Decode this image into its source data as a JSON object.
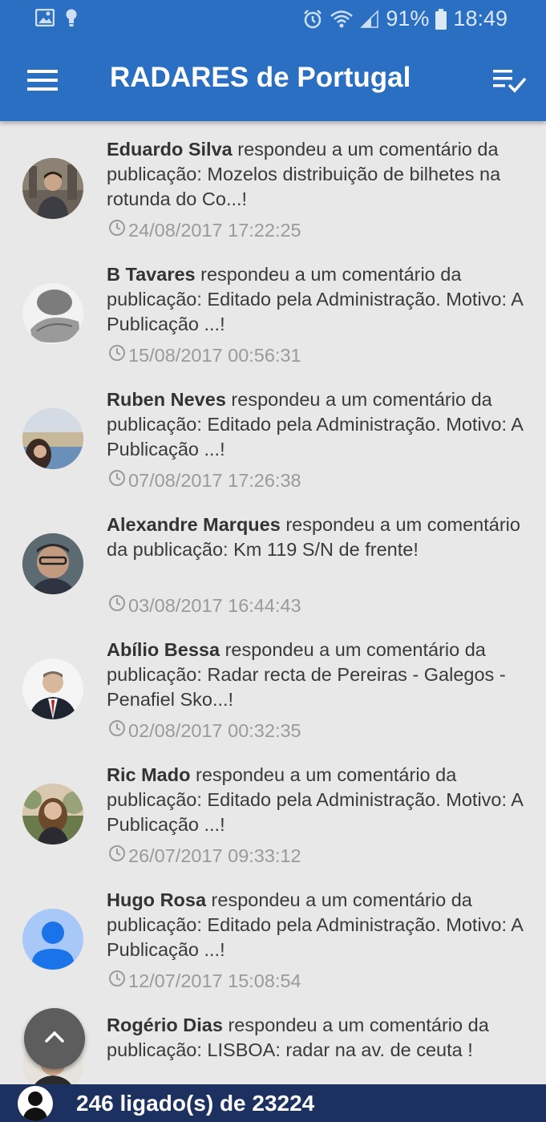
{
  "status_bar": {
    "battery": "91%",
    "time": "18:49"
  },
  "app": {
    "title": "RADARES de Portugal"
  },
  "notifications": [
    {
      "user": "Eduardo Silva",
      "action": " respondeu a um comentário da publicação: Mozelos distribuição de bilhetes na rotunda do Co...!",
      "timestamp": "24/08/2017 17:22:25"
    },
    {
      "user": "B Tavares",
      "action": " respondeu a um comentário da publicação: Editado pela Administração. Motivo: A Publicação ...!",
      "timestamp": "15/08/2017 00:56:31"
    },
    {
      "user": "Ruben Neves",
      "action": " respondeu a um comentário da publicação: Editado pela Administração. Motivo: A Publicação ...!",
      "timestamp": "07/08/2017 17:26:38"
    },
    {
      "user": "Alexandre Marques",
      "action": " respondeu a um comentário da publicação: Km 119 S/N de frente!",
      "timestamp": "03/08/2017 16:44:43"
    },
    {
      "user": "Abílio Bessa",
      "action": " respondeu a um comentário da publicação: Radar recta de Pereiras - Galegos - Penafiel Sko...!",
      "timestamp": "02/08/2017 00:32:35"
    },
    {
      "user": "Ric Mado",
      "action": " respondeu a um comentário da publicação: Editado pela Administração. Motivo: A Publicação ...!",
      "timestamp": "26/07/2017 09:33:12"
    },
    {
      "user": "Hugo Rosa",
      "action": " respondeu a um comentário da publicação: Editado pela Administração. Motivo: A Publicação ...!",
      "timestamp": "12/07/2017 15:08:54"
    },
    {
      "user": "Rogério Dias",
      "action": " respondeu a um comentário da publicação: LISBOA: radar na av. de ceuta !",
      "timestamp": ""
    }
  ],
  "footer": {
    "online_text": "246 ligado(s) de 23224"
  },
  "colors": {
    "app_bar": "#2a6fc1",
    "footer": "#1c3160",
    "background": "#e8e8e8",
    "fab": "#5d5d5d"
  }
}
